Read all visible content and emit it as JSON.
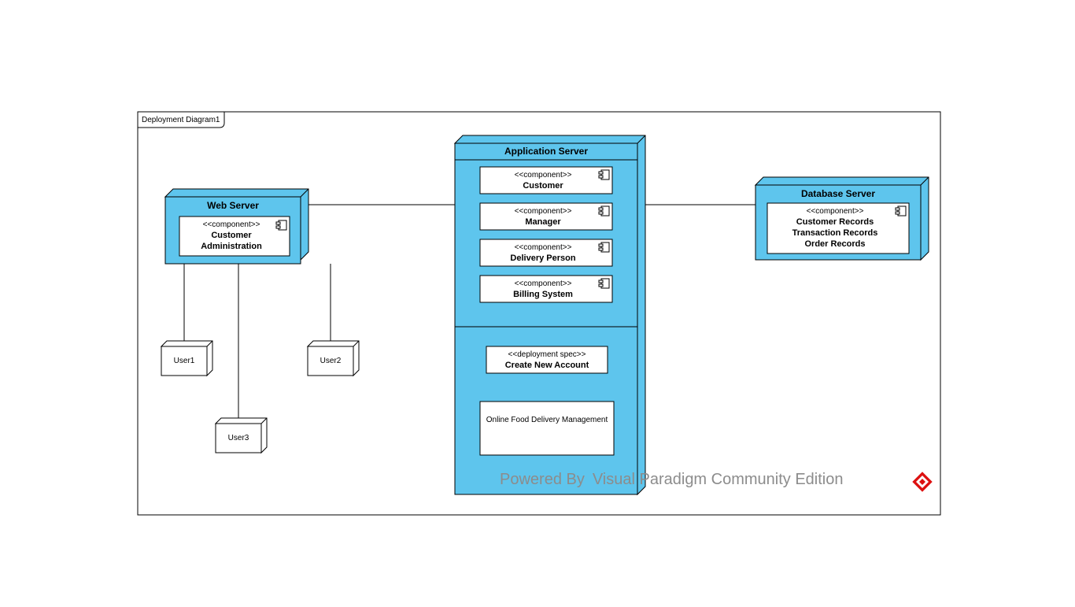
{
  "frame": {
    "title": "Deployment Diagram1"
  },
  "nodes": {
    "webServer": {
      "title": "Web Server",
      "components": [
        {
          "stereotype": "<<component>>",
          "name": "Customer",
          "name2": "Administration"
        }
      ]
    },
    "appServer": {
      "title": "Application Server",
      "components": [
        {
          "stereotype": "<<component>>",
          "name": "Customer"
        },
        {
          "stereotype": "<<component>>",
          "name": "Manager"
        },
        {
          "stereotype": "<<component>>",
          "name": "Delivery Person"
        },
        {
          "stereotype": "<<component>>",
          "name": "Billing System"
        }
      ],
      "deploymentSpec": {
        "stereotype": "<<deployment spec>>",
        "name": "Create New Account"
      },
      "artifact": {
        "name": "Online Food Delivery Management"
      }
    },
    "dbServer": {
      "title": "Database Server",
      "component": {
        "stereotype": "<<component>>",
        "line1": "Customer Records",
        "line2": "Transaction Records",
        "line3": "Order Records"
      }
    },
    "users": {
      "u1": "User1",
      "u2": "User2",
      "u3": "User3"
    }
  },
  "watermark": "Powered By Visual Paradigm Community Edition",
  "colors": {
    "nodeFill": "#5ec5ed",
    "compFill": "#ffffff",
    "stroke": "#000000"
  }
}
